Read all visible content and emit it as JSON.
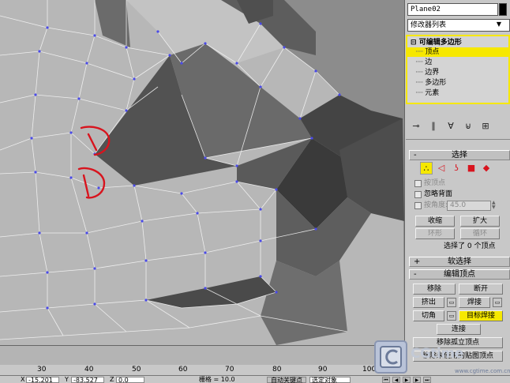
{
  "object_name": "Plane02",
  "object_color": "#000000",
  "modifier_list_label": "修改器列表",
  "modifier_stack": {
    "root": "可编辑多边形",
    "items": [
      {
        "label": "顶点",
        "selected": true
      },
      {
        "label": "边",
        "selected": false
      },
      {
        "label": "边界",
        "selected": false
      },
      {
        "label": "多边形",
        "selected": false
      },
      {
        "label": "元素",
        "selected": false
      }
    ]
  },
  "toolbar_icons": [
    "pin-stack-icon",
    "show-end-result-icon",
    "make-unique-icon",
    "remove-modifier-icon",
    "configure-sets-icon"
  ],
  "selection_rollout": {
    "title": "选择",
    "subobject_icons": [
      "vertex-icon",
      "edge-icon",
      "border-icon",
      "polygon-icon",
      "element-icon"
    ],
    "by_vertex": "按顶点",
    "ignore_backfacing": "忽略背面",
    "by_angle": "按角度:",
    "angle_value": "45.0",
    "shrink": "收缩",
    "grow": "扩大",
    "ring": "环形",
    "loop": "循环",
    "status": "选择了 0 个顶点"
  },
  "soft_selection_rollout": {
    "title": "软选择"
  },
  "edit_vertices_rollout": {
    "title": "编辑顶点",
    "remove": "移除",
    "break": "断开",
    "extrude": "挤出",
    "weld": "焊接",
    "chamfer": "切角",
    "target_weld": "目标焊接",
    "connect": "连接",
    "remove_isolated": "移除孤立顶点",
    "remove_unused_map": "移除未使用的贴图顶点"
  },
  "timeline": {
    "ticks": [
      "30",
      "40",
      "50",
      "60",
      "70",
      "80",
      "90",
      "100"
    ]
  },
  "status_bar": {
    "x_label": "X",
    "x_value": "-15.201",
    "y_label": "Y",
    "y_value": "-83.527",
    "z_label": "Z",
    "z_value": "0.0",
    "grid": "栅格 = 10.0",
    "auto_key": "自动关键点",
    "selection_mode": "选定对象"
  },
  "watermark": {
    "brand": "CGtime",
    "url": "www.cgtime.com.cn"
  },
  "colors": {
    "highlight": "#f6e800",
    "panel_bg": "#c8c8c8",
    "viewport_bg": "#8e8e8e",
    "annotation_red": "#d8141e",
    "vertex_blue": "#4a4ae8"
  }
}
